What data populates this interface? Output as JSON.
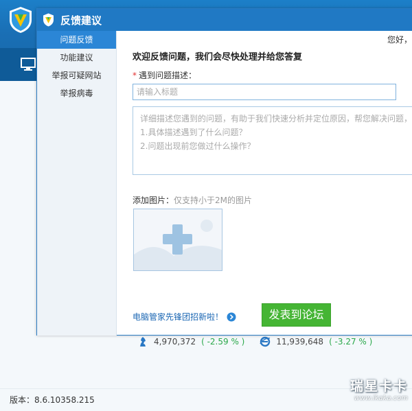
{
  "app": {
    "version_label": "版本：8.6.10358.215",
    "stats": [
      {
        "icon": "horse-icon",
        "value": "4,970,372",
        "change": "( -2.59 % )"
      },
      {
        "icon": "ie-icon",
        "value": "11,939,648",
        "change": "( -3.27 % )"
      }
    ],
    "watermark": {
      "brand": "瑞星卡卡",
      "url": "www.ikaka.com"
    }
  },
  "dialog": {
    "title": "反馈建议",
    "sidebar": [
      {
        "label": "问题反馈",
        "active": true
      },
      {
        "label": "功能建议",
        "active": false
      },
      {
        "label": "举报可疑网站",
        "active": false
      },
      {
        "label": "举报病毒",
        "active": false
      }
    ],
    "greeting": "您好，",
    "welcome": "欢迎反馈问题，我们会尽快处理并给您答复",
    "title_field": {
      "required_mark": "*",
      "label": "遇到问题描述：",
      "placeholder": "请输入标题"
    },
    "description": {
      "lines": [
        "详细描述您遇到的问题，有助于我们快速分析并定位原因，帮您解决问题，",
        "1.具体描述遇到了什么问题？",
        "2.问题出现前您做过什么操作？"
      ]
    },
    "image": {
      "label": "添加图片：",
      "hint": "仅支持小于2M的图片"
    },
    "recruit_link": "电脑管家先锋团招新啦！",
    "post_button": "发表到论坛"
  },
  "colors": {
    "title_bar": "#2079c4",
    "active_tab": "#2b86d6",
    "post_button": "#45b534",
    "link": "#1a66b3",
    "required": "#e23232",
    "percent": "#2aa84a"
  }
}
